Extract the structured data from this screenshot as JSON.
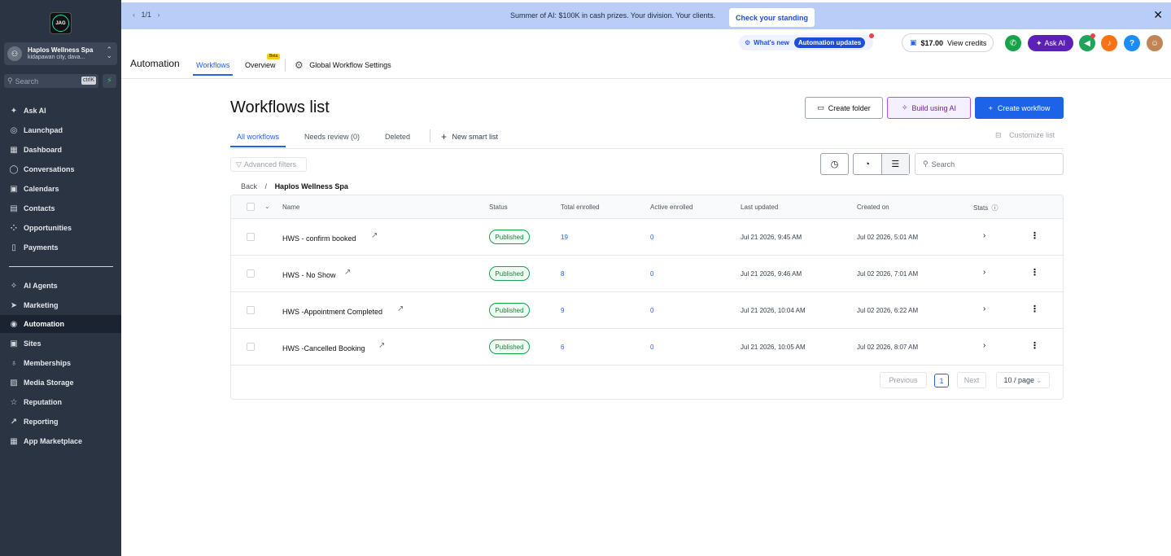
{
  "sidebar": {
    "logo_text": "JAG",
    "account": {
      "name": "Haplos Wellness Spa",
      "location": "kidapawan city, dava..."
    },
    "search": {
      "placeholder": "Search",
      "shortcut": "ctrlK"
    },
    "items": [
      {
        "label": "Ask AI",
        "icon": "sparkle-icon",
        "glyph": "✦"
      },
      {
        "label": "Launchpad",
        "icon": "rocket-icon",
        "glyph": "◎"
      },
      {
        "label": "Dashboard",
        "icon": "dashboard-icon",
        "glyph": "▦"
      },
      {
        "label": "Conversations",
        "icon": "chat-icon",
        "glyph": "◯"
      },
      {
        "label": "Calendars",
        "icon": "calendar-icon",
        "glyph": "▣"
      },
      {
        "label": "Contacts",
        "icon": "contacts-icon",
        "glyph": "▤"
      },
      {
        "label": "Opportunities",
        "icon": "opportunities-icon",
        "glyph": "⁘"
      },
      {
        "label": "Payments",
        "icon": "payments-icon",
        "glyph": "▯"
      },
      {
        "label": "AI Agents",
        "icon": "ai-agents-icon",
        "glyph": "✧"
      },
      {
        "label": "Marketing",
        "icon": "send-icon",
        "glyph": "➤"
      },
      {
        "label": "Automation",
        "icon": "automation-icon",
        "glyph": "◉"
      },
      {
        "label": "Sites",
        "icon": "sites-icon",
        "glyph": "▣"
      },
      {
        "label": "Memberships",
        "icon": "membership-icon",
        "glyph": "♁"
      },
      {
        "label": "Media Storage",
        "icon": "media-icon",
        "glyph": "▨"
      },
      {
        "label": "Reputation",
        "icon": "star-icon",
        "glyph": "☆"
      },
      {
        "label": "Reporting",
        "icon": "trend-icon",
        "glyph": "↗"
      },
      {
        "label": "App Marketplace",
        "icon": "apps-icon",
        "glyph": "▦"
      }
    ]
  },
  "banner": {
    "pager": "1/1",
    "message": "Summer of AI: $100K in cash prizes. Your division. Your clients.",
    "cta": "Check your standing"
  },
  "header": {
    "title": "Automation",
    "tabs": {
      "workflows": "Workflows",
      "overview": "Overview",
      "overview_badge": "Beta",
      "settings": "Global Workflow Settings"
    },
    "whats_new": "What's new",
    "whats_new_pill": "Automation updates",
    "credits_amount": "$17.00",
    "credits_link": "View credits",
    "ask_ai": "Ask AI",
    "help": "?"
  },
  "main": {
    "title": "Workflows list",
    "buttons": {
      "create_folder": "Create folder",
      "build_ai": "Build using AI",
      "create_workflow": "Create workflow"
    },
    "list_tabs": {
      "all": "All workflows",
      "review": "Needs review (0)",
      "deleted": "Deleted",
      "new_smart": "New smart list"
    },
    "customize": "Customize list",
    "advanced_filters": "Advanced filters",
    "search_placeholder": "Search",
    "breadcrumb": {
      "back": "Back",
      "separator": "/",
      "current": "Haplos Wellness Spa"
    },
    "columns": [
      "Name",
      "Status",
      "Total enrolled",
      "Active enrolled",
      "Last updated",
      "Created on",
      "Stats"
    ],
    "rows": [
      {
        "name": "HWS  - confirm booked",
        "status": "Published",
        "total": "19",
        "active": "0",
        "updated": "Jul 21 2026, 9:45 AM",
        "created": "Jul 02 2026, 5:01 AM"
      },
      {
        "name": "HWS - No Show",
        "status": "Published",
        "total": "8",
        "active": "0",
        "updated": "Jul 21 2026, 9:46 AM",
        "created": "Jul 02 2026, 7:01 AM"
      },
      {
        "name": "HWS -Appointment Completed",
        "status": "Published",
        "total": "9",
        "active": "0",
        "updated": "Jul 21 2026, 10:04 AM",
        "created": "Jul 02 2026, 6:22 AM"
      },
      {
        "name": "HWS -Cancelled Booking",
        "status": "Published",
        "total": "6",
        "active": "0",
        "updated": "Jul 21 2026, 10:05 AM",
        "created": "Jul 02 2026, 8:07 AM"
      }
    ],
    "pagination": {
      "previous": "Previous",
      "page": "1",
      "next": "Next",
      "per_page": "10 / page"
    }
  },
  "colors": {
    "sidebar": "#2b3443",
    "primary": "#1d63e8",
    "banner": "#b9cdf8",
    "published": "#16a34a"
  }
}
